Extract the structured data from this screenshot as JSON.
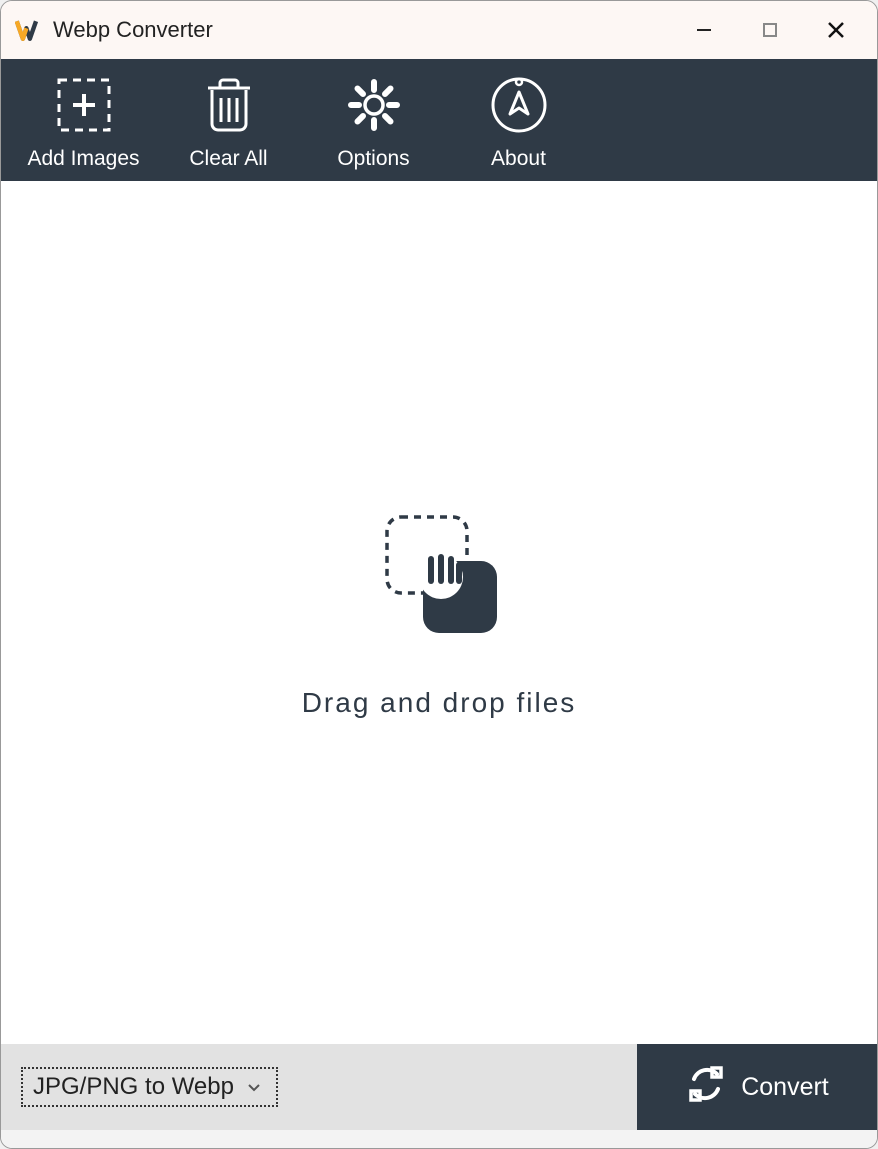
{
  "window": {
    "title": "Webp Converter"
  },
  "toolbar": {
    "add_images": "Add Images",
    "clear_all": "Clear All",
    "options": "Options",
    "about": "About"
  },
  "dropzone": {
    "text": "Drag and drop files"
  },
  "footer": {
    "format_selected": "JPG/PNG to Webp",
    "convert_label": "Convert"
  },
  "colors": {
    "toolbar_bg": "#2f3a46",
    "titlebar_bg": "#fdf7f4",
    "footer_left_bg": "#e2e2e2",
    "logo_accent": "#f7a825"
  }
}
